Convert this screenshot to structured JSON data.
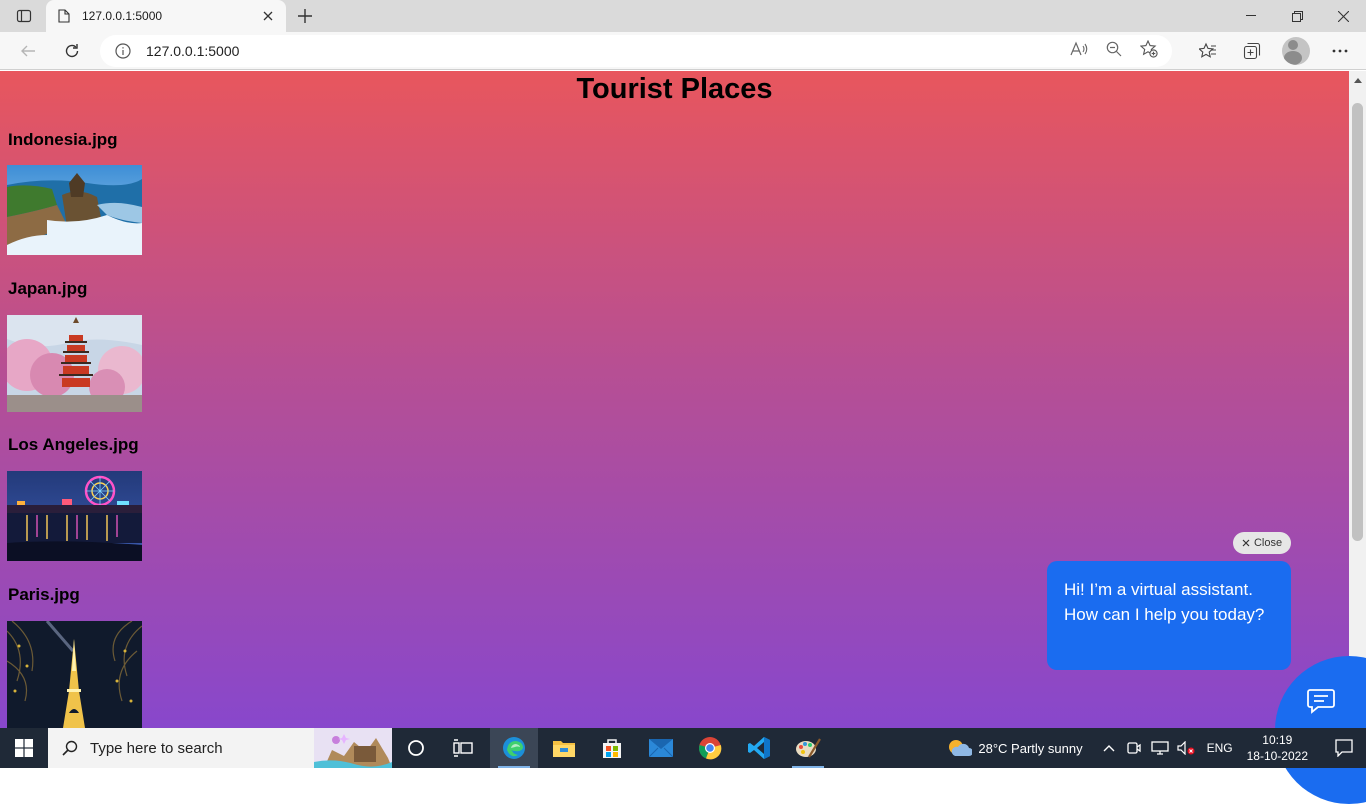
{
  "browser": {
    "tab_title": "127.0.0.1:5000",
    "url": "127.0.0.1:5000"
  },
  "page": {
    "heading": "Tourist Places",
    "places": [
      {
        "label": "Indonesia.jpg"
      },
      {
        "label": "Japan.jpg"
      },
      {
        "label": "Los Angeles.jpg"
      },
      {
        "label": "Paris.jpg"
      }
    ]
  },
  "chat": {
    "close_label": "Close",
    "message": "Hi! I’m a virtual assistant. How can I help you today?"
  },
  "taskbar": {
    "search_placeholder": "Type here to search",
    "weather": "28°C  Partly sunny",
    "language": "ENG",
    "time": "10:19",
    "date": "18-10-2022"
  }
}
